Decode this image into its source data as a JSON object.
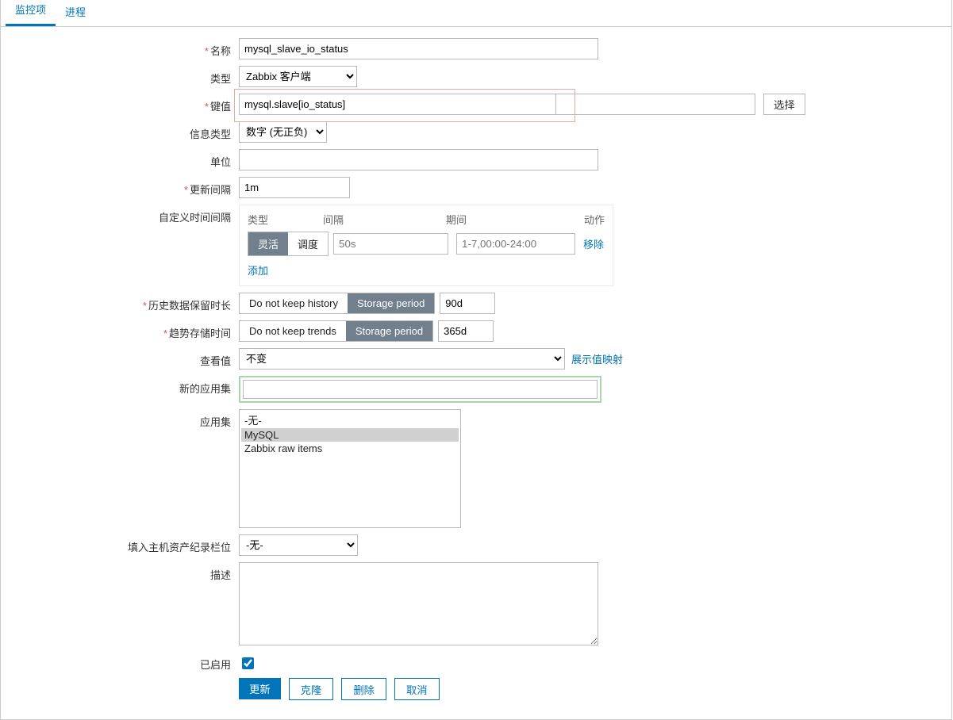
{
  "tabs": {
    "monitor": "监控项",
    "process": "进程"
  },
  "labels": {
    "name": "名称",
    "type": "类型",
    "key": "键值",
    "infoType": "信息类型",
    "unit": "单位",
    "updateInterval": "更新间隔",
    "customIntervals": "自定义时间间隔",
    "history": "历史数据保留时长",
    "trends": "趋势存储时间",
    "valueView": "查看值",
    "newApp": "新的应用集",
    "apps": "应用集",
    "inventory": "填入主机资产纪录栏位",
    "description": "描述",
    "enabled": "已启用"
  },
  "values": {
    "name": "mysql_slave_io_status",
    "type": "Zabbix 客户端",
    "key": "mysql.slave[io_status]",
    "infoType": "数字 (无正负)",
    "unit": "",
    "updateInterval": "1m",
    "historyPeriod": "90d",
    "trendPeriod": "365d",
    "valueView": "不变",
    "inventory": "-无-",
    "enabled": true
  },
  "apps": [
    {
      "label": "-无-",
      "selected": false
    },
    {
      "label": "MySQL",
      "selected": true
    },
    {
      "label": "Zabbix raw items",
      "selected": false
    }
  ],
  "intervals": {
    "headers": {
      "type": "类型",
      "interval": "间隔",
      "period": "期间",
      "action": "动作"
    },
    "seg": {
      "flex": "灵活",
      "schedule": "调度"
    },
    "row": {
      "intervalPH": "50s",
      "periodPH": "1-7,00:00-24:00"
    },
    "remove": "移除",
    "add": "添加"
  },
  "radios": {
    "noHistory": "Do not keep history",
    "storagePeriod": "Storage period",
    "noTrends": "Do not keep trends"
  },
  "buttons": {
    "select": "选择",
    "showMap": "展示值映射",
    "update": "更新",
    "clone": "克隆",
    "delete": "删除",
    "cancel": "取消"
  }
}
